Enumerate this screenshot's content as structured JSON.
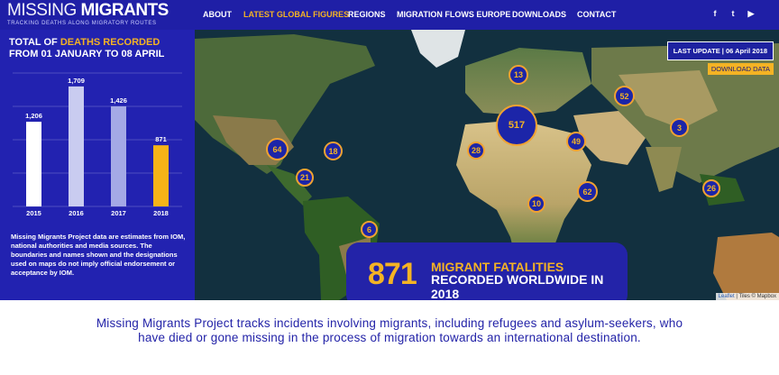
{
  "header": {
    "logo_part1": "MISSING",
    "logo_part2": "MIGRANTS",
    "tagline": "TRACKING DEATHS ALONG MIGRATORY ROUTES",
    "nav": [
      {
        "label": "ABOUT",
        "active": false
      },
      {
        "label": "LATEST GLOBAL FIGURES",
        "active": true
      },
      {
        "label": "REGIONS",
        "active": false
      },
      {
        "label": "MIGRATION FLOWS EUROPE",
        "active": false
      },
      {
        "label": "DOWNLOADS",
        "active": false
      },
      {
        "label": "CONTACT",
        "active": false
      }
    ],
    "social": [
      {
        "icon": "facebook-icon",
        "glyph": "f"
      },
      {
        "icon": "twitter-icon",
        "glyph": "t"
      },
      {
        "icon": "youtube-icon",
        "glyph": "▶"
      }
    ]
  },
  "panel": {
    "title_prefix": "TOTAL OF",
    "title_highlight": "DEATHS RECORDED",
    "title_line2": "FROM 01 JANUARY TO 08 APRIL",
    "note": "Missing Migrants Project data are estimates from IOM, national authorities and media sources. The boundaries and names shown and the designations used on maps do not imply official endorsement or acceptance by IOM."
  },
  "chart_data": {
    "type": "bar",
    "categories": [
      "2015",
      "2016",
      "2017",
      "2018"
    ],
    "values": [
      1206,
      1709,
      1426,
      871
    ],
    "value_labels": [
      "1,206",
      "1,709",
      "1,426",
      "871"
    ],
    "colors": [
      "#ffffff",
      "#c9ccf0",
      "#a4a9e6",
      "#f6b417"
    ],
    "ylim": [
      0,
      1900
    ],
    "grid": true,
    "title": "",
    "xlabel": "",
    "ylabel": ""
  },
  "map": {
    "last_update": "LAST UPDATE | 06 April 2018",
    "download": "DOWNLOAD DATA",
    "markers": [
      "13",
      "52",
      "517",
      "3",
      "64",
      "18",
      "28",
      "49",
      "21",
      "62",
      "10",
      "26",
      "6"
    ],
    "fatalities_number": "871",
    "fatalities_line1": "MIGRANT FATALITIES",
    "fatalities_line2": "RECORDED WORLDWIDE IN 2018",
    "attribution_link": "Leaflet",
    "attribution_rest": "| Tiles © Mapbox",
    "colors": {
      "marker_border": "#f0a232",
      "marker_fill": "#1c25a8",
      "accent": "#f4b324"
    }
  },
  "description": "Missing Migrants Project tracks incidents involving migrants, including refugees and asylum-seekers, who have died or gone missing in the process of migration towards an international destination."
}
